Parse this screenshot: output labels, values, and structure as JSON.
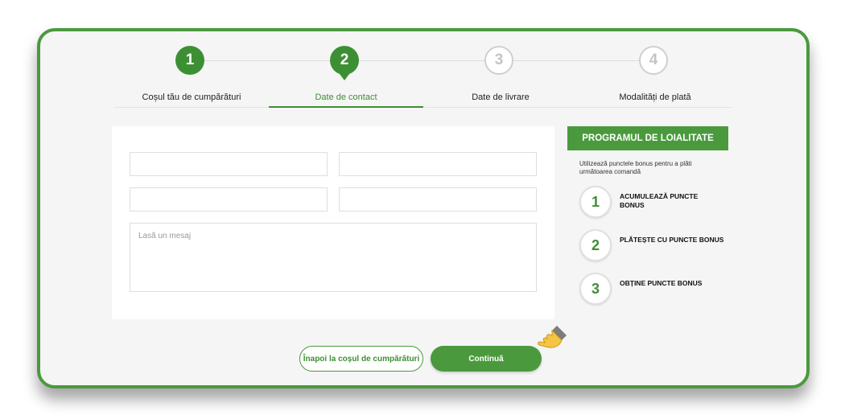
{
  "stepper": {
    "steps": [
      {
        "number": "1",
        "label": "Coșul tău de cumpărături",
        "state": "done"
      },
      {
        "number": "2",
        "label": "Date de contact",
        "state": "current"
      },
      {
        "number": "3",
        "label": "Date de livrare",
        "state": "todo"
      },
      {
        "number": "4",
        "label": "Modalități de plată",
        "state": "todo"
      }
    ]
  },
  "form": {
    "field1": {
      "value": "",
      "placeholder": ""
    },
    "field2": {
      "value": "",
      "placeholder": ""
    },
    "field3": {
      "value": "",
      "placeholder": ""
    },
    "field4": {
      "value": "",
      "placeholder": ""
    },
    "message": {
      "value": "",
      "placeholder": "Lasă un mesaj"
    }
  },
  "loyalty": {
    "title": "PROGRAMUL DE LOIALITATE",
    "description": "Utilizează punctele bonus pentru a plăti următoarea comandă",
    "items": [
      {
        "number": "1",
        "text": "ACUMULEAZĂ PUNCTE BONUS"
      },
      {
        "number": "2",
        "text": "PLĂTEȘTE CU PUNCTE BONUS"
      },
      {
        "number": "3",
        "text": "OBȚINE PUNCTE BONUS"
      }
    ]
  },
  "buttons": {
    "back_label": "Înapoi la coșul de cumpărături",
    "continue_label": "Continuă"
  },
  "colors": {
    "accent": "#4a9a3d",
    "accent_dark": "#3d8f33",
    "frame_border": "#4a9a3d",
    "inactive": "#cfcfcf"
  },
  "icons": {
    "pointer": "hand-pointer-icon"
  }
}
